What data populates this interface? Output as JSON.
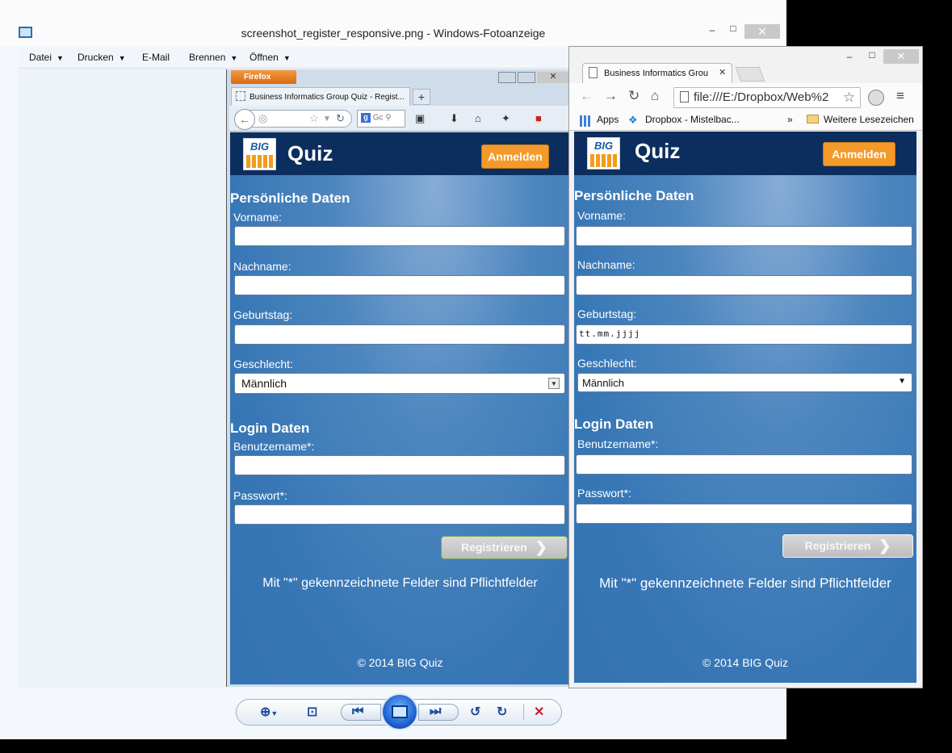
{
  "viewer": {
    "title": "screenshot_register_responsive.png - Windows-Fotoanzeige",
    "menu": [
      "Datei",
      "Drucken",
      "E-Mail",
      "Brennen",
      "Öffnen"
    ],
    "window_buttons": {
      "minimize": "–",
      "maximize": "□",
      "close": "✕"
    }
  },
  "firefox": {
    "app_button": "Firefox",
    "tab_title": "Business Informatics Group Quiz - Regist...",
    "new_tab": "+",
    "search_placeholder": "Gc"
  },
  "chrome": {
    "tab_title": "Business Informatics Grou",
    "tab_close": "✕",
    "url": "file:///E:/Dropbox/Web%2",
    "bookmarks": [
      "Apps",
      "Dropbox - Mistelbac...",
      "»",
      "Weitere Lesezeichen"
    ],
    "window_buttons": {
      "minimize": "–",
      "maximize": "□",
      "close": "✕"
    }
  },
  "quiz": {
    "logo": "BIG",
    "title": "Quiz",
    "login_button": "Anmelden",
    "personal_section": "Persönliche Daten",
    "first_name_label": "Vorname:",
    "last_name_label": "Nachname:",
    "birthday_label": "Geburtstag:",
    "birthday_placeholder": "tt.mm.jjjj",
    "gender_label": "Geschlecht:",
    "gender_value": "Männlich",
    "login_section": "Login Daten",
    "username_label": "Benutzername*:",
    "password_label": "Passwort*:",
    "register_button": "Registrieren",
    "required_note": "Mit \"*\" gekennzeichnete Felder sind Pflichtfelder",
    "footer": "© 2014 BIG Quiz"
  },
  "colors": {
    "header": "#0c2e5e",
    "accent": "#f49a2a",
    "page": "#3877b6"
  }
}
